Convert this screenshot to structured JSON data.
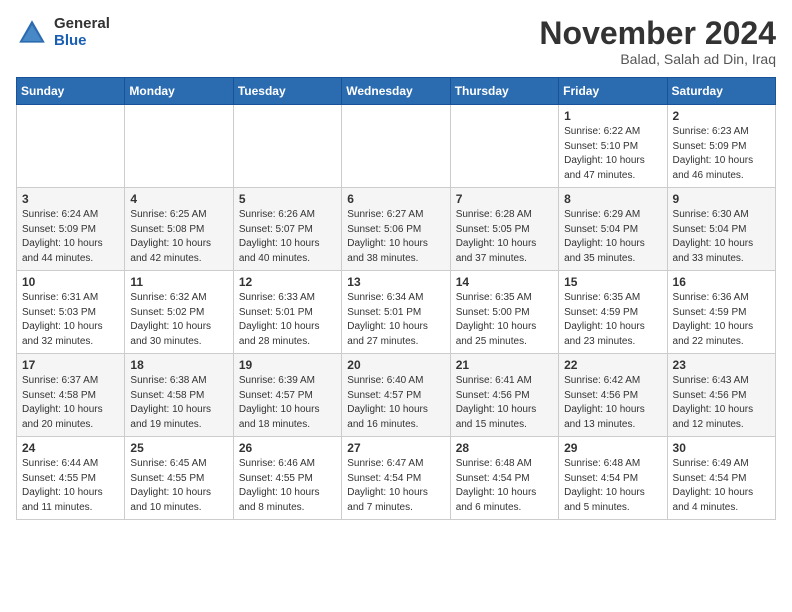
{
  "header": {
    "logo_general": "General",
    "logo_blue": "Blue",
    "month_title": "November 2024",
    "location": "Balad, Salah ad Din, Iraq"
  },
  "calendar": {
    "days_of_week": [
      "Sunday",
      "Monday",
      "Tuesday",
      "Wednesday",
      "Thursday",
      "Friday",
      "Saturday"
    ],
    "weeks": [
      [
        {
          "day": "",
          "info": ""
        },
        {
          "day": "",
          "info": ""
        },
        {
          "day": "",
          "info": ""
        },
        {
          "day": "",
          "info": ""
        },
        {
          "day": "",
          "info": ""
        },
        {
          "day": "1",
          "info": "Sunrise: 6:22 AM\nSunset: 5:10 PM\nDaylight: 10 hours\nand 47 minutes."
        },
        {
          "day": "2",
          "info": "Sunrise: 6:23 AM\nSunset: 5:09 PM\nDaylight: 10 hours\nand 46 minutes."
        }
      ],
      [
        {
          "day": "3",
          "info": "Sunrise: 6:24 AM\nSunset: 5:09 PM\nDaylight: 10 hours\nand 44 minutes."
        },
        {
          "day": "4",
          "info": "Sunrise: 6:25 AM\nSunset: 5:08 PM\nDaylight: 10 hours\nand 42 minutes."
        },
        {
          "day": "5",
          "info": "Sunrise: 6:26 AM\nSunset: 5:07 PM\nDaylight: 10 hours\nand 40 minutes."
        },
        {
          "day": "6",
          "info": "Sunrise: 6:27 AM\nSunset: 5:06 PM\nDaylight: 10 hours\nand 38 minutes."
        },
        {
          "day": "7",
          "info": "Sunrise: 6:28 AM\nSunset: 5:05 PM\nDaylight: 10 hours\nand 37 minutes."
        },
        {
          "day": "8",
          "info": "Sunrise: 6:29 AM\nSunset: 5:04 PM\nDaylight: 10 hours\nand 35 minutes."
        },
        {
          "day": "9",
          "info": "Sunrise: 6:30 AM\nSunset: 5:04 PM\nDaylight: 10 hours\nand 33 minutes."
        }
      ],
      [
        {
          "day": "10",
          "info": "Sunrise: 6:31 AM\nSunset: 5:03 PM\nDaylight: 10 hours\nand 32 minutes."
        },
        {
          "day": "11",
          "info": "Sunrise: 6:32 AM\nSunset: 5:02 PM\nDaylight: 10 hours\nand 30 minutes."
        },
        {
          "day": "12",
          "info": "Sunrise: 6:33 AM\nSunset: 5:01 PM\nDaylight: 10 hours\nand 28 minutes."
        },
        {
          "day": "13",
          "info": "Sunrise: 6:34 AM\nSunset: 5:01 PM\nDaylight: 10 hours\nand 27 minutes."
        },
        {
          "day": "14",
          "info": "Sunrise: 6:35 AM\nSunset: 5:00 PM\nDaylight: 10 hours\nand 25 minutes."
        },
        {
          "day": "15",
          "info": "Sunrise: 6:35 AM\nSunset: 4:59 PM\nDaylight: 10 hours\nand 23 minutes."
        },
        {
          "day": "16",
          "info": "Sunrise: 6:36 AM\nSunset: 4:59 PM\nDaylight: 10 hours\nand 22 minutes."
        }
      ],
      [
        {
          "day": "17",
          "info": "Sunrise: 6:37 AM\nSunset: 4:58 PM\nDaylight: 10 hours\nand 20 minutes."
        },
        {
          "day": "18",
          "info": "Sunrise: 6:38 AM\nSunset: 4:58 PM\nDaylight: 10 hours\nand 19 minutes."
        },
        {
          "day": "19",
          "info": "Sunrise: 6:39 AM\nSunset: 4:57 PM\nDaylight: 10 hours\nand 18 minutes."
        },
        {
          "day": "20",
          "info": "Sunrise: 6:40 AM\nSunset: 4:57 PM\nDaylight: 10 hours\nand 16 minutes."
        },
        {
          "day": "21",
          "info": "Sunrise: 6:41 AM\nSunset: 4:56 PM\nDaylight: 10 hours\nand 15 minutes."
        },
        {
          "day": "22",
          "info": "Sunrise: 6:42 AM\nSunset: 4:56 PM\nDaylight: 10 hours\nand 13 minutes."
        },
        {
          "day": "23",
          "info": "Sunrise: 6:43 AM\nSunset: 4:56 PM\nDaylight: 10 hours\nand 12 minutes."
        }
      ],
      [
        {
          "day": "24",
          "info": "Sunrise: 6:44 AM\nSunset: 4:55 PM\nDaylight: 10 hours\nand 11 minutes."
        },
        {
          "day": "25",
          "info": "Sunrise: 6:45 AM\nSunset: 4:55 PM\nDaylight: 10 hours\nand 10 minutes."
        },
        {
          "day": "26",
          "info": "Sunrise: 6:46 AM\nSunset: 4:55 PM\nDaylight: 10 hours\nand 8 minutes."
        },
        {
          "day": "27",
          "info": "Sunrise: 6:47 AM\nSunset: 4:54 PM\nDaylight: 10 hours\nand 7 minutes."
        },
        {
          "day": "28",
          "info": "Sunrise: 6:48 AM\nSunset: 4:54 PM\nDaylight: 10 hours\nand 6 minutes."
        },
        {
          "day": "29",
          "info": "Sunrise: 6:48 AM\nSunset: 4:54 PM\nDaylight: 10 hours\nand 5 minutes."
        },
        {
          "day": "30",
          "info": "Sunrise: 6:49 AM\nSunset: 4:54 PM\nDaylight: 10 hours\nand 4 minutes."
        }
      ]
    ]
  }
}
